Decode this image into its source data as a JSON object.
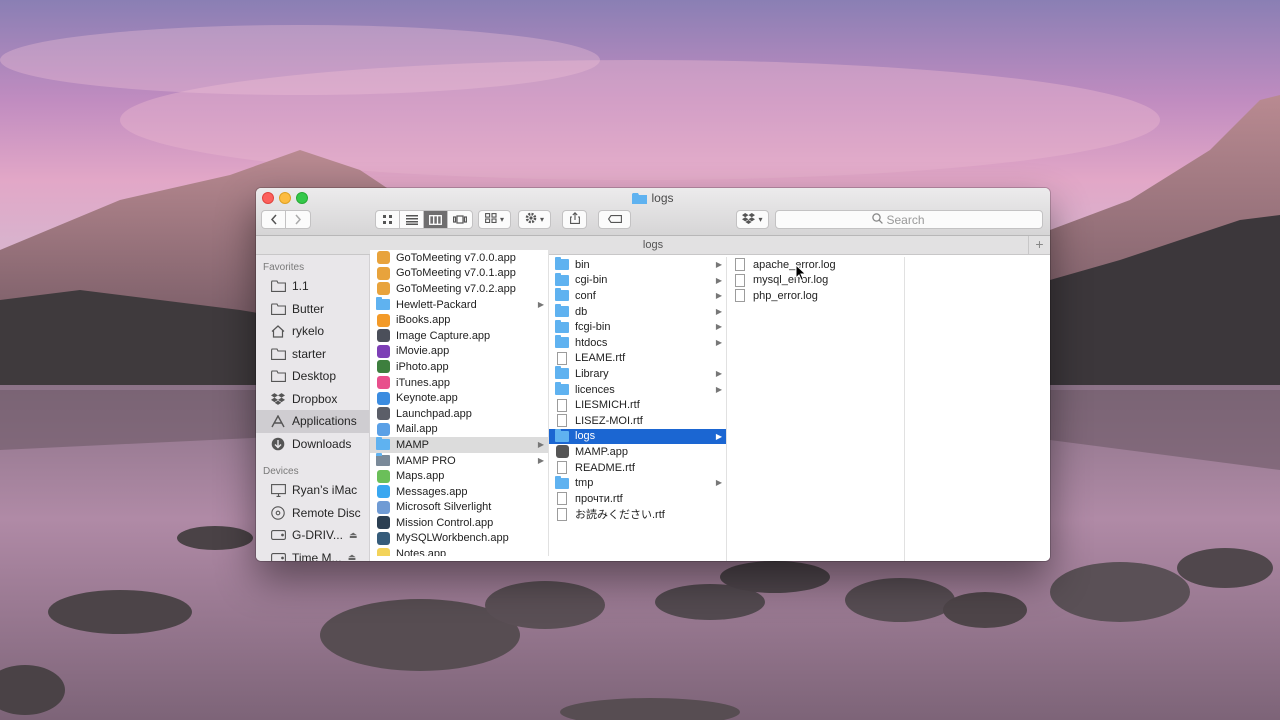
{
  "window": {
    "title": "logs",
    "path_label": "logs",
    "search_placeholder": "Search",
    "add_tab": "+"
  },
  "toolbar": {
    "back_icon": "chevron-left-icon",
    "forward_icon": "chevron-right-icon",
    "view_modes": [
      "icon-view-icon",
      "list-view-icon",
      "column-view-icon",
      "cover-flow-icon"
    ],
    "active_view": "column-view-icon",
    "arrange_icon": "arrange-grid-icon",
    "action_icon": "gear-icon",
    "share_icon": "share-icon",
    "tag_icon": "tag-icon",
    "dropbox_icon": "dropbox-icon"
  },
  "sidebar": {
    "favorites_header": "Favorites",
    "favorites": [
      {
        "label": "1.1",
        "icon": "folder-icon"
      },
      {
        "label": "Butter",
        "icon": "folder-icon"
      },
      {
        "label": "rykelo",
        "icon": "home-icon"
      },
      {
        "label": "starter",
        "icon": "folder-icon"
      },
      {
        "label": "Desktop",
        "icon": "folder-icon"
      },
      {
        "label": "Dropbox",
        "icon": "dropbox-icon"
      },
      {
        "label": "Applications",
        "icon": "applications-icon"
      },
      {
        "label": "Downloads",
        "icon": "downloads-icon"
      }
    ],
    "selected": "Applications",
    "devices_header": "Devices",
    "devices": [
      {
        "label": "Ryan’s iMac",
        "icon": "imac-icon"
      },
      {
        "label": "Remote Disc",
        "icon": "disc-icon"
      },
      {
        "label": "G-DRIV...",
        "icon": "drive-icon",
        "eject": "⏏"
      },
      {
        "label": "Time M...",
        "icon": "drive-icon",
        "eject": "⏏"
      }
    ]
  },
  "column1": {
    "items": [
      {
        "label": "GoToMeeting v7.0.0.app",
        "kind": "app",
        "color": "#e8a33c"
      },
      {
        "label": "GoToMeeting v7.0.1.app",
        "kind": "app",
        "color": "#e8a33c"
      },
      {
        "label": "GoToMeeting v7.0.2.app",
        "kind": "app",
        "color": "#e8a33c"
      },
      {
        "label": "Hewlett-Packard",
        "kind": "folder"
      },
      {
        "label": "iBooks.app",
        "kind": "app",
        "color": "#f39a28"
      },
      {
        "label": "Image Capture.app",
        "kind": "app",
        "color": "#4b4f5a"
      },
      {
        "label": "iMovie.app",
        "kind": "app",
        "color": "#7d3fb6"
      },
      {
        "label": "iPhoto.app",
        "kind": "app",
        "color": "#3d7f3e"
      },
      {
        "label": "iTunes.app",
        "kind": "app",
        "color": "#e84f8c"
      },
      {
        "label": "Keynote.app",
        "kind": "app",
        "color": "#3b8ce0"
      },
      {
        "label": "Launchpad.app",
        "kind": "app",
        "color": "#5b5e68"
      },
      {
        "label": "Mail.app",
        "kind": "app",
        "color": "#5aa0e6"
      },
      {
        "label": "MAMP",
        "kind": "folder"
      },
      {
        "label": "MAMP PRO",
        "kind": "folder-dark"
      },
      {
        "label": "Maps.app",
        "kind": "app",
        "color": "#6bbf59"
      },
      {
        "label": "Messages.app",
        "kind": "app",
        "color": "#39a7f0"
      },
      {
        "label": "Microsoft Silverlight",
        "kind": "app",
        "color": "#6f9bd4"
      },
      {
        "label": "Mission Control.app",
        "kind": "app",
        "color": "#2b3f52"
      },
      {
        "label": "MySQLWorkbench.app",
        "kind": "app",
        "color": "#365c7a"
      },
      {
        "label": "Notes.app",
        "kind": "app",
        "color": "#f3d35a"
      }
    ],
    "selected": "MAMP"
  },
  "column2": {
    "items": [
      {
        "label": "bin",
        "kind": "folder"
      },
      {
        "label": "cgi-bin",
        "kind": "folder"
      },
      {
        "label": "conf",
        "kind": "folder"
      },
      {
        "label": "db",
        "kind": "folder"
      },
      {
        "label": "fcgi-bin",
        "kind": "folder"
      },
      {
        "label": "htdocs",
        "kind": "folder"
      },
      {
        "label": "LEAME.rtf",
        "kind": "doc"
      },
      {
        "label": "Library",
        "kind": "folder"
      },
      {
        "label": "licences",
        "kind": "folder"
      },
      {
        "label": "LIESMICH.rtf",
        "kind": "doc"
      },
      {
        "label": "LISEZ-MOI.rtf",
        "kind": "doc"
      },
      {
        "label": "logs",
        "kind": "folder"
      },
      {
        "label": "MAMP.app",
        "kind": "app",
        "color": "#555555"
      },
      {
        "label": "README.rtf",
        "kind": "doc"
      },
      {
        "label": "tmp",
        "kind": "folder"
      },
      {
        "label": "прочти.rtf",
        "kind": "doc"
      },
      {
        "label": "お読みください.rtf",
        "kind": "doc"
      }
    ],
    "selected": "logs"
  },
  "column3": {
    "items": [
      {
        "label": "apache_error.log",
        "kind": "doc"
      },
      {
        "label": "mysql_error.log",
        "kind": "doc"
      },
      {
        "label": "php_error.log",
        "kind": "doc"
      }
    ]
  },
  "colors": {
    "selection_blue": "#1b66d2",
    "folder_blue": "#5fb2f0"
  }
}
